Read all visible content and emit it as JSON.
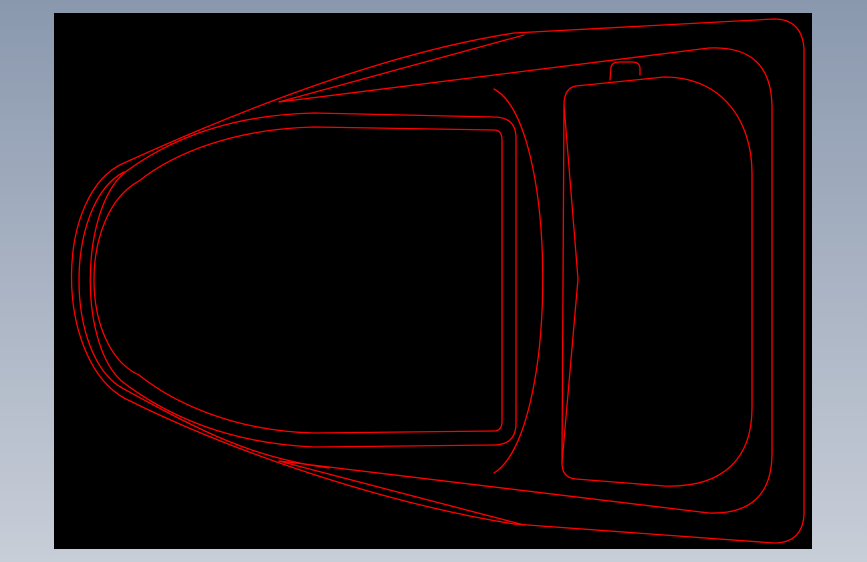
{
  "backdrop": {
    "color_top": "#8a98ae",
    "color_bottom": "#c8ced8"
  },
  "viewport": {
    "background": "#000000"
  },
  "drawing": {
    "line_color": "#ff0000"
  }
}
